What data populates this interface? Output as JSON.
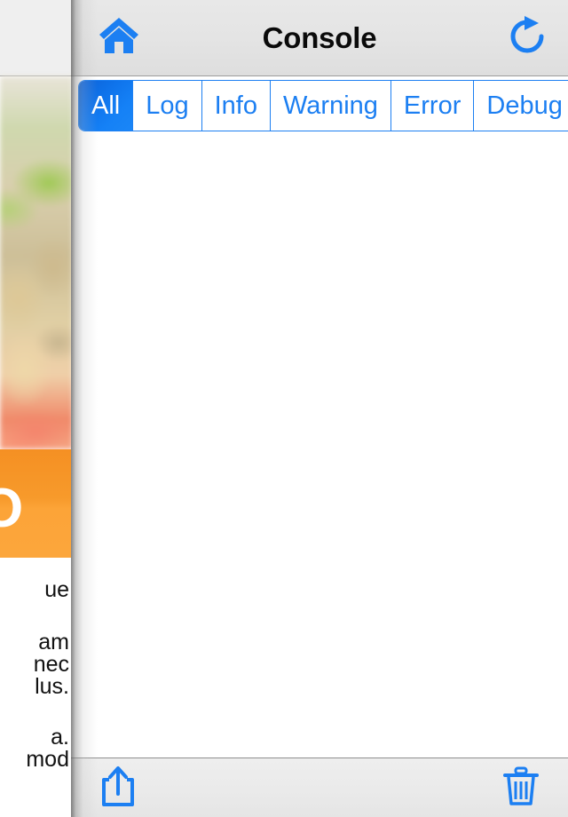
{
  "background_app": {
    "banner_letter_fragment": "O",
    "text_fragments": [
      "ue",
      "",
      "am",
      "nec",
      "lus.",
      "",
      "a.",
      "mod"
    ]
  },
  "console": {
    "navbar": {
      "home_icon": "home-icon",
      "title": "Console",
      "refresh_icon": "refresh-icon"
    },
    "filter_tabs": [
      {
        "label": "All",
        "selected": true
      },
      {
        "label": "Log",
        "selected": false
      },
      {
        "label": "Info",
        "selected": false
      },
      {
        "label": "Warning",
        "selected": false
      },
      {
        "label": "Error",
        "selected": false
      },
      {
        "label": "Debug",
        "selected": false
      }
    ],
    "log_entries": [],
    "toolbar": {
      "share_icon": "share-icon",
      "trash_icon": "trash-icon"
    }
  },
  "colors": {
    "accent_blue": "#1c7ff2",
    "selected_blue": "#0f74ec",
    "navbar_gray": "#e5e5e5",
    "banner_orange": "#fca438"
  }
}
